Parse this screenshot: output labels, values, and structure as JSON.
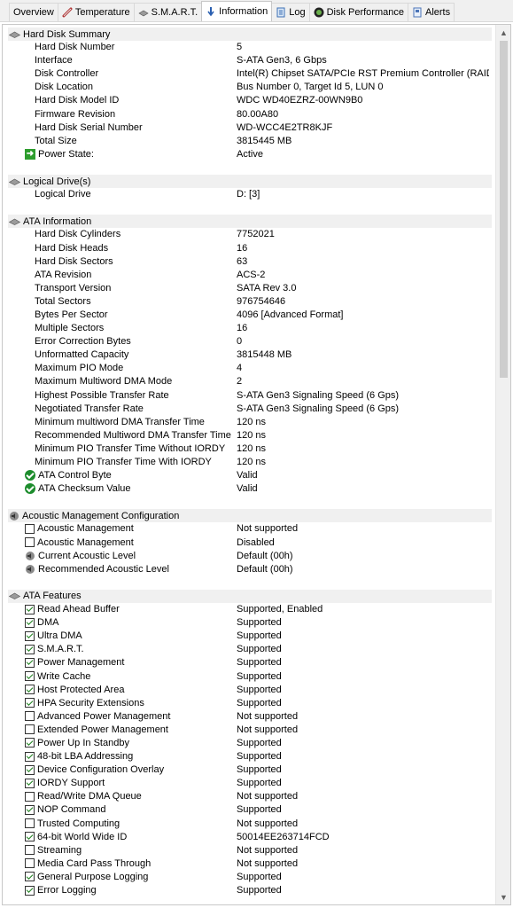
{
  "tabs": [
    {
      "label": "Overview",
      "icon": "none"
    },
    {
      "label": "Temperature",
      "icon": "thermometer-icon"
    },
    {
      "label": "S.M.A.R.T.",
      "icon": "disk-icon"
    },
    {
      "label": "Information",
      "icon": "info-icon"
    },
    {
      "label": "Log",
      "icon": "log-icon"
    },
    {
      "label": "Disk Performance",
      "icon": "performance-icon"
    },
    {
      "label": "Alerts",
      "icon": "alerts-icon"
    }
  ],
  "active_tab": "Information",
  "summary": {
    "title": "Hard Disk Summary",
    "rows": [
      {
        "label": "Hard Disk Number",
        "value": "5"
      },
      {
        "label": "Interface",
        "value": "S-ATA Gen3, 6 Gbps"
      },
      {
        "label": "Disk Controller",
        "value": "Intel(R) Chipset SATA/PCIe RST Premium Controller (RAID) [VEN:..."
      },
      {
        "label": "Disk Location",
        "value": "Bus Number 0, Target Id 5, LUN 0"
      },
      {
        "label": "Hard Disk Model ID",
        "value": "WDC WD40EZRZ-00WN9B0"
      },
      {
        "label": "Firmware Revision",
        "value": "80.00A80"
      },
      {
        "label": "Hard Disk Serial Number",
        "value": "WD-WCC4E2TR8KJF"
      },
      {
        "label": "Total Size",
        "value": "3815445 MB"
      }
    ],
    "power_label": "Power State:",
    "power_value": "Active"
  },
  "logical": {
    "title": "Logical Drive(s)",
    "rows": [
      {
        "label": "Logical Drive",
        "value": "D: [3]"
      }
    ]
  },
  "ata_info": {
    "title": "ATA Information",
    "rows": [
      {
        "label": "Hard Disk Cylinders",
        "value": "7752021"
      },
      {
        "label": "Hard Disk Heads",
        "value": "16"
      },
      {
        "label": "Hard Disk Sectors",
        "value": "63"
      },
      {
        "label": "ATA Revision",
        "value": "ACS-2"
      },
      {
        "label": "Transport Version",
        "value": "SATA Rev 3.0"
      },
      {
        "label": "Total Sectors",
        "value": "976754646"
      },
      {
        "label": "Bytes Per Sector",
        "value": "4096 [Advanced Format]"
      },
      {
        "label": "Multiple Sectors",
        "value": "16"
      },
      {
        "label": "Error Correction Bytes",
        "value": "0"
      },
      {
        "label": "Unformatted Capacity",
        "value": "3815448 MB"
      },
      {
        "label": "Maximum PIO Mode",
        "value": "4"
      },
      {
        "label": "Maximum Multiword DMA Mode",
        "value": "2"
      },
      {
        "label": "Highest Possible Transfer Rate",
        "value": "S-ATA Gen3 Signaling Speed (6 Gps)"
      },
      {
        "label": "Negotiated Transfer Rate",
        "value": "S-ATA Gen3 Signaling Speed (6 Gps)"
      },
      {
        "label": "Minimum multiword DMA Transfer Time",
        "value": "120 ns"
      },
      {
        "label": "Recommended Multiword DMA Transfer Time",
        "value": "120 ns"
      },
      {
        "label": "Minimum PIO Transfer Time Without IORDY",
        "value": "120 ns"
      },
      {
        "label": "Minimum PIO Transfer Time With IORDY",
        "value": "120 ns"
      }
    ],
    "status_rows": [
      {
        "label": "ATA Control Byte",
        "value": "Valid"
      },
      {
        "label": "ATA Checksum Value",
        "value": "Valid"
      }
    ]
  },
  "acoustic": {
    "title": "Acoustic Management Configuration",
    "check_rows": [
      {
        "label": "Acoustic Management",
        "value": "Not supported",
        "checked": false
      },
      {
        "label": "Acoustic Management",
        "value": "Disabled",
        "checked": false
      }
    ],
    "level_rows": [
      {
        "label": "Current Acoustic Level",
        "value": "Default (00h)"
      },
      {
        "label": "Recommended Acoustic Level",
        "value": "Default (00h)"
      }
    ]
  },
  "features": {
    "title": "ATA Features",
    "rows": [
      {
        "label": "Read Ahead Buffer",
        "value": "Supported, Enabled",
        "checked": true
      },
      {
        "label": "DMA",
        "value": "Supported",
        "checked": true
      },
      {
        "label": "Ultra DMA",
        "value": "Supported",
        "checked": true
      },
      {
        "label": "S.M.A.R.T.",
        "value": "Supported",
        "checked": true
      },
      {
        "label": "Power Management",
        "value": "Supported",
        "checked": true
      },
      {
        "label": "Write Cache",
        "value": "Supported",
        "checked": true
      },
      {
        "label": "Host Protected Area",
        "value": "Supported",
        "checked": true
      },
      {
        "label": "HPA Security Extensions",
        "value": "Supported",
        "checked": true
      },
      {
        "label": "Advanced Power Management",
        "value": "Not supported",
        "checked": false
      },
      {
        "label": "Extended Power Management",
        "value": "Not supported",
        "checked": false
      },
      {
        "label": "Power Up In Standby",
        "value": "Supported",
        "checked": true
      },
      {
        "label": "48-bit LBA Addressing",
        "value": "Supported",
        "checked": true
      },
      {
        "label": "Device Configuration Overlay",
        "value": "Supported",
        "checked": true
      },
      {
        "label": "IORDY Support",
        "value": "Supported",
        "checked": true
      },
      {
        "label": "Read/Write DMA Queue",
        "value": "Not supported",
        "checked": false
      },
      {
        "label": "NOP Command",
        "value": "Supported",
        "checked": true
      },
      {
        "label": "Trusted Computing",
        "value": "Not supported",
        "checked": false
      },
      {
        "label": "64-bit World Wide ID",
        "value": "50014EE263714FCD",
        "checked": true
      },
      {
        "label": "Streaming",
        "value": "Not supported",
        "checked": false
      },
      {
        "label": "Media Card Pass Through",
        "value": "Not supported",
        "checked": false
      },
      {
        "label": "General Purpose Logging",
        "value": "Supported",
        "checked": true
      },
      {
        "label": "Error Logging",
        "value": "Supported",
        "checked": true
      }
    ]
  },
  "colors": {
    "section_bg": "#f0f0f0",
    "check_green": "#1a7f1a",
    "status_green": "#1c8c2c"
  }
}
